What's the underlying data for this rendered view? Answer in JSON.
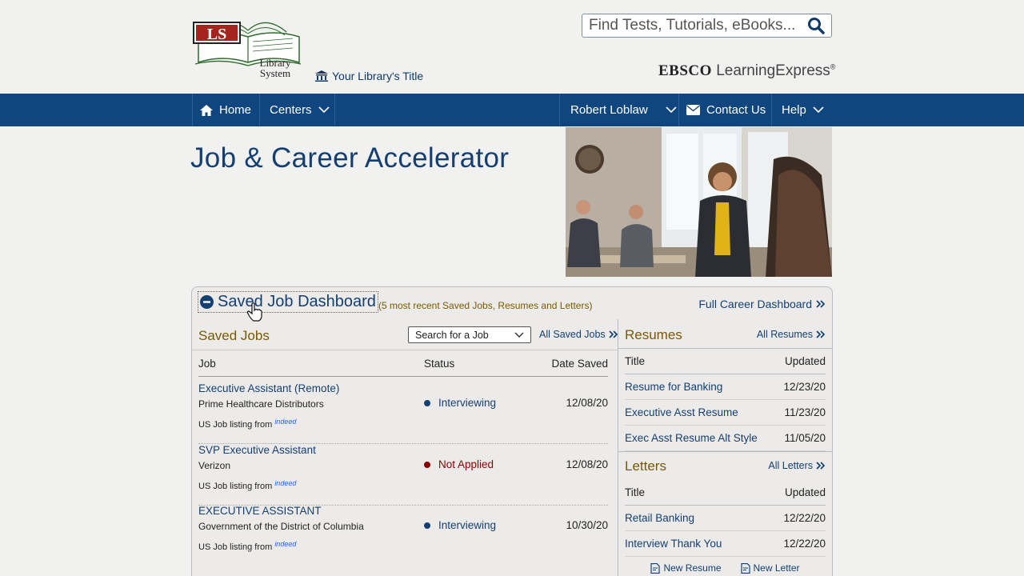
{
  "header": {
    "logo_letters": "LS",
    "logo_line1": "Library",
    "logo_line2": "System",
    "library_title": "Your Library's Title",
    "search_placeholder": "Find Tests, Tutorials, eBooks...",
    "brand_ebsco": "EBSCO",
    "brand_product": "LearningExpress",
    "brand_mark": "®"
  },
  "nav": {
    "home": "Home",
    "centers": "Centers",
    "user": "Robert Loblaw",
    "contact": "Contact Us",
    "help": "Help"
  },
  "page_title": "Job & Career Accelerator",
  "dashboard": {
    "title": "Saved Job Dashboard",
    "subtitle": "(5 most recent Saved Jobs, Resumes and Letters)",
    "full_link": "Full Career Dashboard",
    "saved_jobs": {
      "title": "Saved Jobs",
      "search_select": "Search for a Job",
      "all_link": "All Saved Jobs",
      "columns": {
        "job": "Job",
        "status": "Status",
        "date": "Date Saved"
      },
      "source_text": "US Job listing from",
      "source_brand": "indeed",
      "rows": [
        {
          "title": "Executive Assistant (Remote)",
          "company": "Prime Healthcare Distributors",
          "status": "Interviewing",
          "status_color": "#143f73",
          "date": "12/08/20"
        },
        {
          "title": "SVP Executive Assistant",
          "company": "Verizon",
          "status": "Not Applied",
          "status_color": "#8b0000",
          "date": "12/08/20"
        },
        {
          "title": "EXECUTIVE ASSISTANT",
          "company": "Government of the District of Columbia",
          "status": "Interviewing",
          "status_color": "#143f73",
          "date": "10/30/20"
        }
      ]
    },
    "resumes": {
      "title": "Resumes",
      "all_link": "All Resumes",
      "columns": {
        "title": "Title",
        "updated": "Updated"
      },
      "rows": [
        {
          "title": "Resume for Banking",
          "date": "12/23/20"
        },
        {
          "title": "Executive Asst Resume",
          "date": "11/23/20"
        },
        {
          "title": "Exec Asst Resume Alt Style",
          "date": "11/05/20"
        }
      ]
    },
    "letters": {
      "title": "Letters",
      "all_link": "All Letters",
      "columns": {
        "title": "Title",
        "updated": "Updated"
      },
      "rows": [
        {
          "title": "Retail Banking",
          "date": "12/22/20"
        },
        {
          "title": "Interview Thank You",
          "date": "12/22/20"
        }
      ]
    },
    "new_resume": "New Resume",
    "new_letter": "New Letter"
  },
  "colors": {
    "nav_bg": "#0f4680",
    "link": "#143f73",
    "section_title": "#7a5a00"
  }
}
